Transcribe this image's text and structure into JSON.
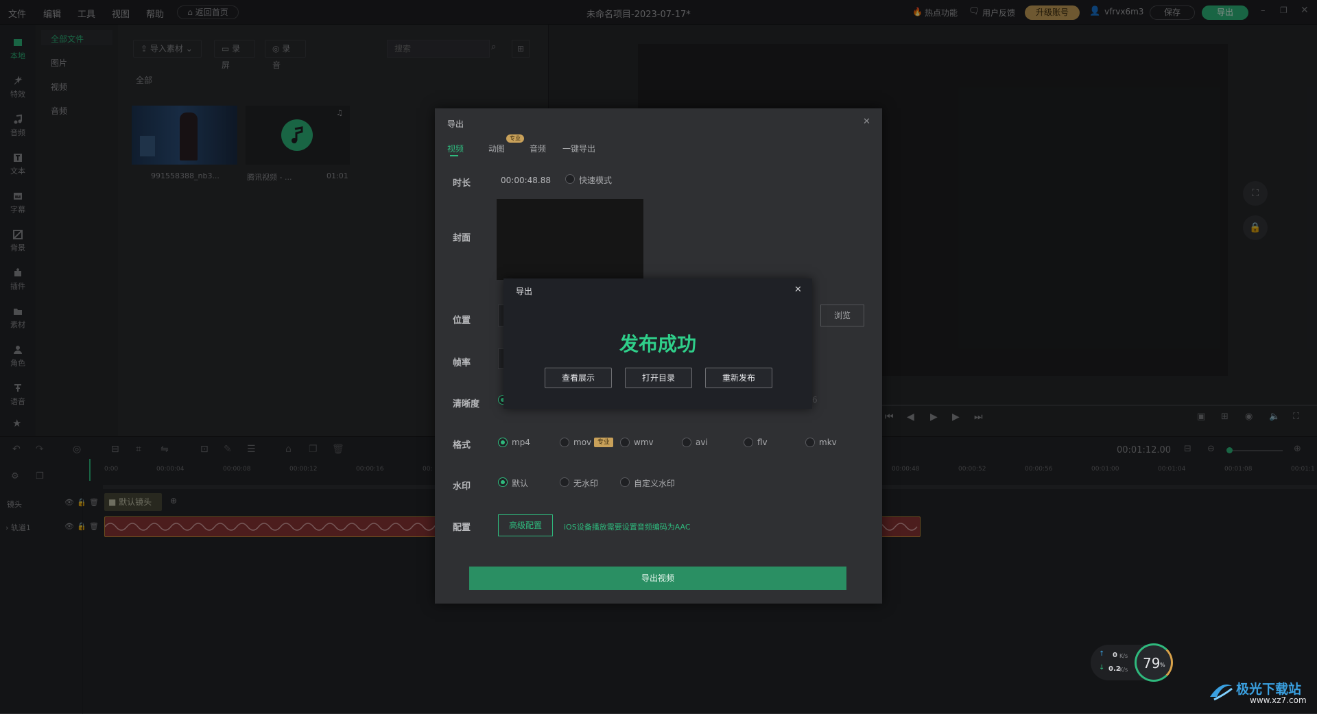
{
  "menu": [
    "文件",
    "编辑",
    "工具",
    "视图",
    "帮助"
  ],
  "topbar": {
    "home_label": "返回首页",
    "project_title": "未命名项目-2023-07-17*",
    "hot_label": "热点功能",
    "feedback_label": "用户反馈",
    "upgrade_label": "升级账号",
    "username": "vfrvx6m3",
    "save_label": "保存",
    "export_label": "导出"
  },
  "rail": [
    "本地",
    "特效",
    "音频",
    "文本",
    "字幕",
    "背景",
    "插件",
    "素材",
    "角色",
    "语音"
  ],
  "categories": [
    "全部文件",
    "图片",
    "视频",
    "音频"
  ],
  "media": {
    "import_label": "导入素材",
    "record_screen_label": "录屏",
    "record_audio_label": "录音",
    "search_placeholder": "搜索",
    "section_label": "全部",
    "items": [
      {
        "name": "991558388_nb3...",
        "duration": ""
      },
      {
        "name": "腾讯视频 - ...",
        "duration": "01:01"
      }
    ]
  },
  "timeline": {
    "time_display": "00:01:12.00",
    "ruler_left": [
      "0:00",
      "00:00:04",
      "00:00:08",
      "00:00:12",
      "00:00:16",
      "00:"
    ],
    "ruler_right": [
      "00:00:48",
      "00:00:52",
      "00:00:56",
      "00:01:00",
      "00:01:04",
      "00:01:08",
      "00:01:1"
    ],
    "track_camera": "镜头",
    "track_1": "轨道1",
    "default_camera": "默认镜头"
  },
  "export": {
    "title": "导出",
    "tabs": [
      "视频",
      "动图",
      "音频",
      "一键导出"
    ],
    "pro_badge": "专业",
    "duration_label": "时长",
    "duration_value": "00:00:48.88",
    "fast_mode": "快速模式",
    "cover_label": "封面",
    "location_label": "位置",
    "browse_label": "浏览",
    "fps_label": "帧率",
    "quality_label": "清晰度",
    "quality_tail": "6",
    "format_label": "格式",
    "formats": [
      "mp4",
      "mov",
      "wmv",
      "avi",
      "flv",
      "mkv"
    ],
    "watermark_label": "水印",
    "watermarks": [
      "默认",
      "无水印",
      "自定义水印"
    ],
    "config_label": "配置",
    "advanced_label": "高级配置",
    "hint": "iOS设备播放需要设置音频编码为AAC",
    "export_video_label": "导出视频"
  },
  "success": {
    "title": "导出",
    "message": "发布成功",
    "buttons": [
      "查看展示",
      "打开目录",
      "重新发布"
    ]
  },
  "netmeter": {
    "up": "0",
    "down": "0.2",
    "unit": "K/s",
    "percent": "79",
    "percent_sign": "%"
  },
  "watermark": {
    "site_name": "极光下载站",
    "site_url": "www.xz7.com"
  },
  "colors": {
    "accent": "#2fb97d",
    "upgrade": "#c9a15a"
  }
}
